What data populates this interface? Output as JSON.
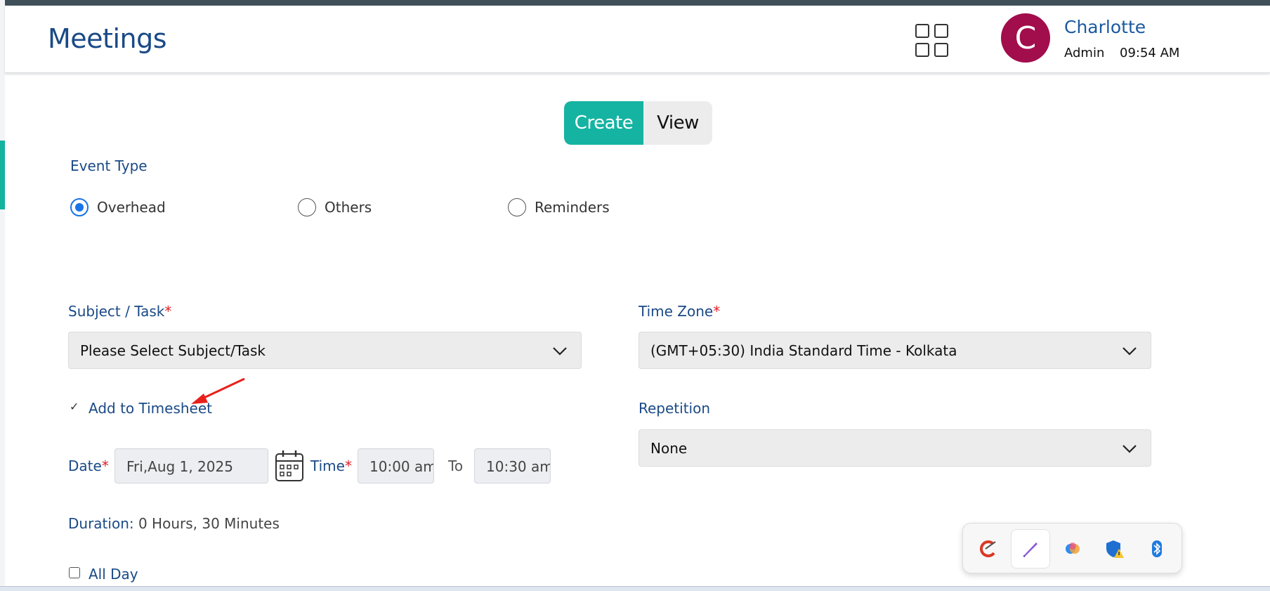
{
  "header": {
    "title": "Meetings",
    "user": {
      "initial": "C",
      "name": "Charlotte",
      "role": "Admin",
      "time": "09:54 AM"
    }
  },
  "mode_toggle": {
    "create": "Create",
    "view": "View",
    "selected": "Create"
  },
  "event_type": {
    "label": "Event Type",
    "options": [
      "Overhead",
      "Others",
      "Reminders"
    ],
    "selected": "Overhead"
  },
  "subject": {
    "label": "Subject / Task",
    "required_mark": "*",
    "value": "Please Select Subject/Task"
  },
  "timezone": {
    "label": "Time Zone",
    "required_mark": "*",
    "value": "(GMT+05:30) India Standard Time - Kolkata"
  },
  "timesheet": {
    "check": "✓",
    "label": "Add to Timesheet"
  },
  "repetition": {
    "label": "Repetition",
    "value": "None"
  },
  "date": {
    "label": "Date",
    "required_mark": "*",
    "value": "Fri,Aug 1, 2025"
  },
  "time": {
    "label": "Time",
    "required_mark": "*",
    "start": "10:00 am",
    "to": "To",
    "end": "10:30 am"
  },
  "duration": {
    "label": "Duration:",
    "value": " 0 Hours, 30 Minutes"
  },
  "all_day": {
    "label": "All Day",
    "checked": false
  },
  "colors": {
    "accent": "#15b3a2",
    "brand_text": "#1a4a86",
    "avatar": "#a20d4c",
    "required": "#e0202a",
    "annotation_arrow": "#e8201c"
  },
  "tray": {
    "icons": [
      "ccleaner-icon",
      "pen-icon",
      "copilot-icon",
      "security-warning-icon",
      "bluetooth-icon"
    ]
  }
}
